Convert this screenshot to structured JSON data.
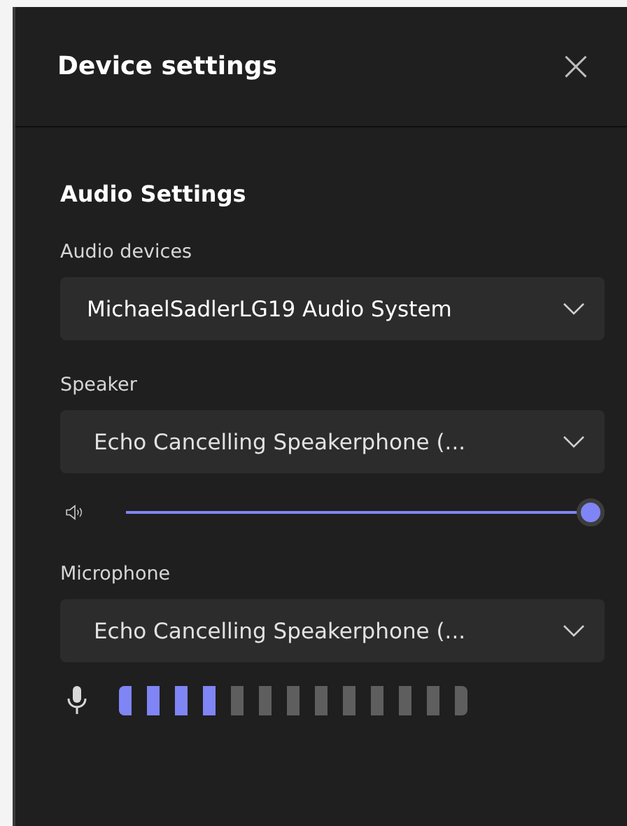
{
  "header": {
    "title": "Device settings",
    "close": "×"
  },
  "section": {
    "title": "Audio Settings"
  },
  "audio_devices": {
    "label": "Audio devices",
    "value": "MichaelSadlerLG19 Audio System"
  },
  "speaker": {
    "label": "Speaker",
    "value": "Echo Cancelling Speakerphone (...",
    "volume": {
      "level": 1
    }
  },
  "microphone": {
    "label": "Microphone",
    "value": "Echo Cancelling Speakerphone (...",
    "meter": {
      "level": 0.32
    }
  }
}
